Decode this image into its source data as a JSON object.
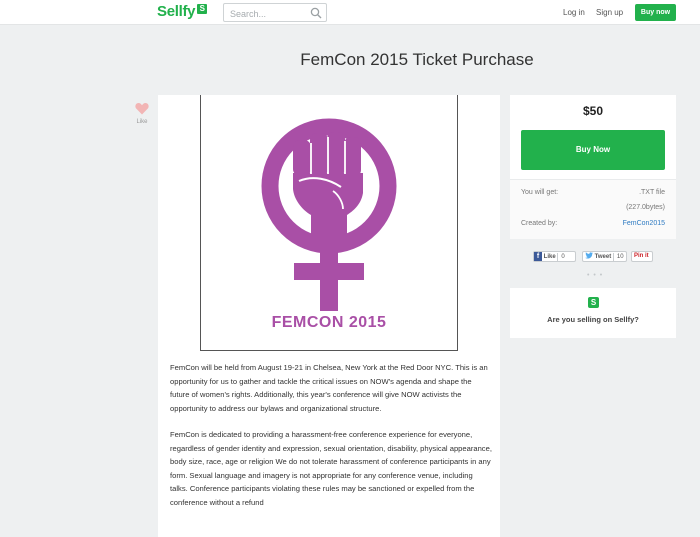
{
  "header": {
    "logo_text": "Sellfy",
    "logo_badge": "S",
    "search_placeholder": "Search...",
    "login_label": "Log in",
    "signup_label": "Sign up",
    "buy_now_label": "Buy now"
  },
  "page": {
    "title": "FemCon 2015 Ticket Purchase"
  },
  "like": {
    "label": "Like"
  },
  "product": {
    "poster_text": "FEMCON 2015",
    "description": [
      "FemCon will be held from August 19-21 in Chelsea, New York at the Red Door NYC. This is an opportunity for us to gather and tackle the critical issues on NOW's agenda and shape the future of women's rights. Additionally, this year's conference will give NOW activists the opportunity to address our bylaws and organizational structure.",
      "FemCon is dedicated to providing a harassment-free conference experience for everyone, regardless of gender identity and expression, sexual orientation, disability, physical appearance, body size, race, age or religion We do not tolerate harassment of conference participants in any form. Sexual language and imagery is not appropriate for any conference venue, including talks. Conference participants violating these rules may be sanctioned or expelled from the conference without a refund"
    ]
  },
  "purchase": {
    "price": "$50",
    "buy_label": "Buy Now",
    "you_will_get_label": "You will get:",
    "file_type": ".TXT file",
    "file_size": "(227.0bytes)",
    "created_by_label": "Created by:",
    "creator": "FemCon2015"
  },
  "share": {
    "fb_like_label": "Like",
    "fb_count": "0",
    "tweet_label": "Tweet",
    "tweet_count": "10",
    "pin_label": "Pin it"
  },
  "sell_prompt": {
    "badge": "S",
    "text": "Are you selling on Sellfy?"
  },
  "colors": {
    "brand_green": "#22b14c",
    "poster_purple": "#a94fa6",
    "link_blue": "#2f7bc2"
  }
}
